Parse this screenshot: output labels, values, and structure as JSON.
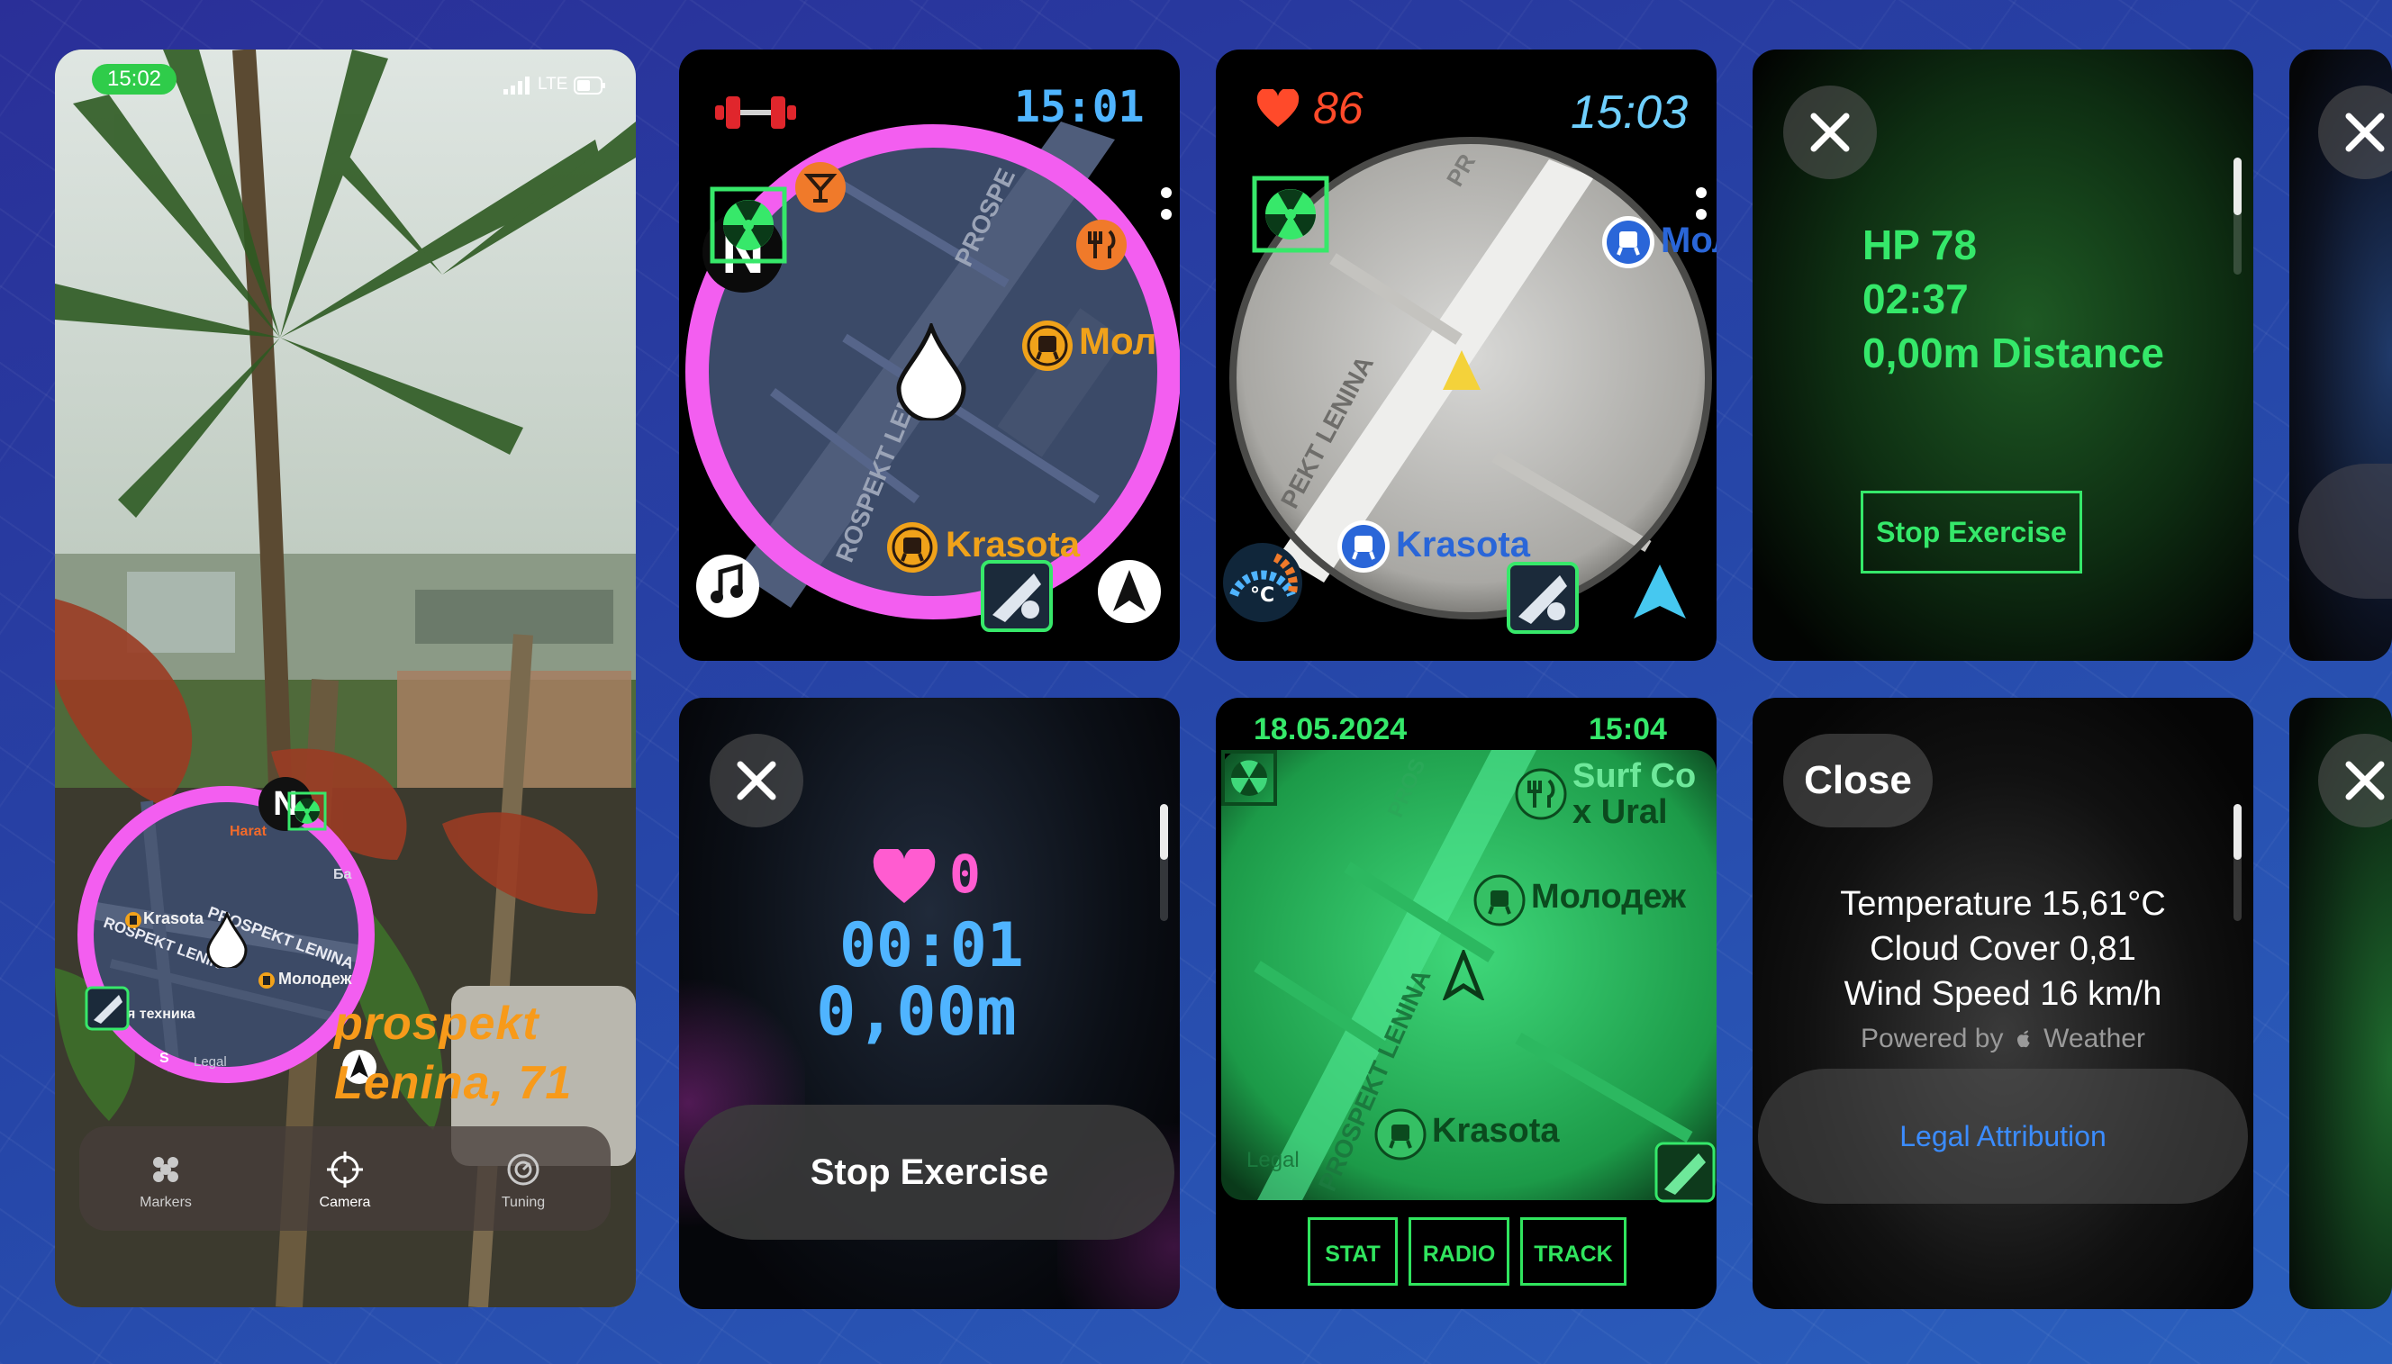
{
  "phone": {
    "status_time": "15:02",
    "carrier": "LTE",
    "map": {
      "labels": {
        "harat": "Harat",
        "ba": "Ба",
        "prospekt_left": "ROSPEKT LENIN",
        "prospekt_right": "PROSPEKT LENINA",
        "krasota": "Krasota",
        "molodezh": "Молодеж",
        "tekhnika": "я техника",
        "legal": "Legal",
        "s": "S"
      },
      "compass": "N"
    },
    "address_line1": "prospekt",
    "address_line2": "Lenina, 71",
    "tabs": [
      {
        "label": "Markers",
        "icon": "markers-icon"
      },
      {
        "label": "Camera",
        "icon": "camera-crosshair-icon"
      },
      {
        "label": "Tuning",
        "icon": "tuning-icon"
      }
    ]
  },
  "watch1": {
    "time": "15:01",
    "compass": "N",
    "labels": {
      "prospe": "PROSPE",
      "prospekt_len": "ROSPEKT LEN",
      "mol": "Мол",
      "krasota": "Krasota"
    },
    "ring_color": "#f35ef0"
  },
  "watch2": {
    "heart_rate": "86",
    "time": "15:03",
    "labels": {
      "pr": "PR",
      "prospekt_lenina": "PEKT LENINA",
      "molod": "Молод",
      "krasota": "Krasota",
      "celsius": "°C"
    }
  },
  "watch3": {
    "hp": "HP 78",
    "timer": "02:37",
    "distance": "0,00m Distance",
    "stop_button": "Stop Exercise"
  },
  "watch4": {
    "heart_rate": "0",
    "timer": "00:01",
    "distance": "0,00m",
    "stop_button": "Stop Exercise"
  },
  "watch5": {
    "date": "18.05.2024",
    "time": "15:04",
    "labels": {
      "surf1": "Surf Co",
      "surf2": "x Ural",
      "molodezh": "Молодеж",
      "krasota": "Krasota",
      "prospekt_lenina": "PROSPEKT LENINA",
      "pros": "PROS",
      "legal": "Legal"
    },
    "buttons": [
      "STAT",
      "RADIO",
      "TRACK"
    ]
  },
  "watch6": {
    "close": "Close",
    "temperature": "Temperature 15,61°C",
    "cloud_cover": "Cloud Cover 0,81",
    "wind_speed": "Wind Speed 16 km/h",
    "powered_by": "Powered by",
    "weather_brand": "Weather",
    "legal_attribution": "Legal Attribution"
  },
  "colors": {
    "pip_green": "#35e86a",
    "accent_blue": "#4fb4ff",
    "ring_pink": "#f35ef0",
    "legal_link": "#3b8cff"
  }
}
